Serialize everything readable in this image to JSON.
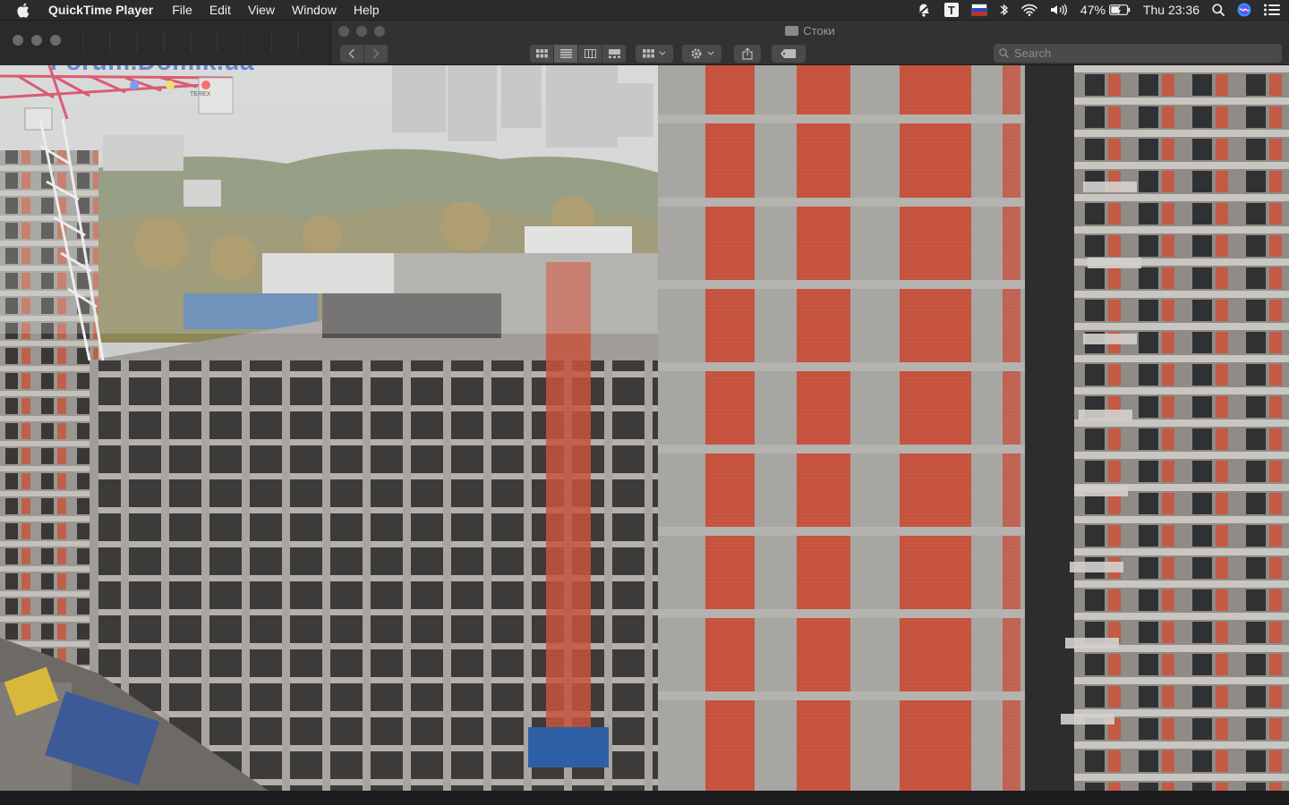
{
  "menubar": {
    "app_name": "QuickTime Player",
    "items": [
      "File",
      "Edit",
      "View",
      "Window",
      "Help"
    ],
    "badge_letter": "T",
    "battery_percent": "47%",
    "clock": "Thu 23:36"
  },
  "finder": {
    "window_title": "Стоки",
    "search_placeholder": "Search"
  },
  "video": {
    "watermark": "Forum.Domik.ua",
    "crane_label": "TEREX"
  },
  "colors": {
    "menubar_bg": "#2b2b2d",
    "brick": "#c8553f",
    "concrete": "#a5a3a0",
    "sky": "#cfd1cf",
    "watermark": "#3f6fc8"
  }
}
